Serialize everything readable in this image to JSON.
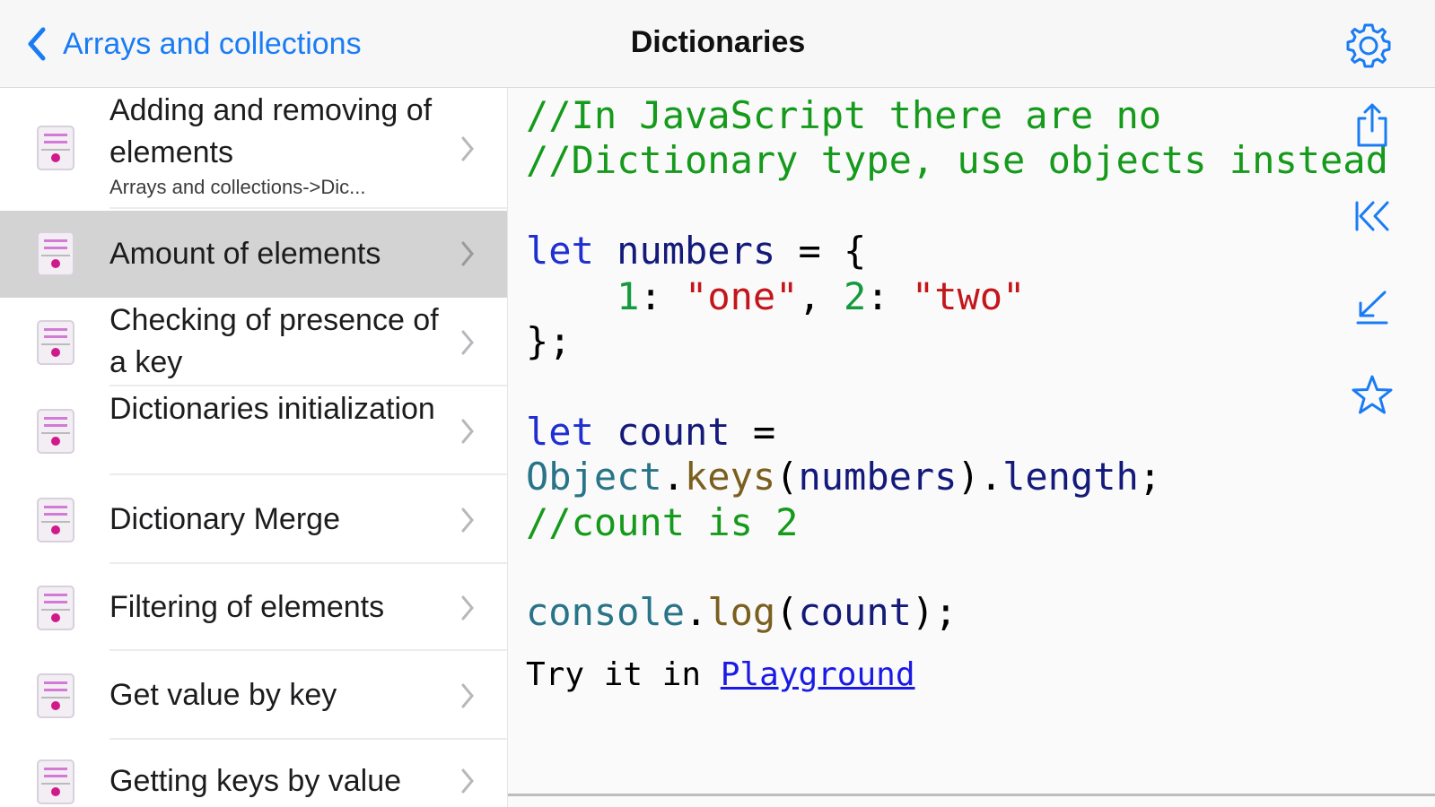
{
  "navbar": {
    "back_label": "Arrays and collections",
    "title": "Dictionaries",
    "settings_icon": "gear-icon",
    "accent": "#1a7cf5"
  },
  "sidebar": {
    "items": [
      {
        "title": "Adding and removing of elements",
        "subtitle": "Arrays and collections->Dic...",
        "selected": false
      },
      {
        "title": "Amount of elements",
        "subtitle": "",
        "selected": true
      },
      {
        "title": "Checking of presence of a key",
        "subtitle": "",
        "selected": false
      },
      {
        "title": "Dictionaries initialization",
        "subtitle": "",
        "selected": false
      },
      {
        "title": "Dictionary Merge",
        "subtitle": "",
        "selected": false
      },
      {
        "title": "Filtering of elements",
        "subtitle": "",
        "selected": false
      },
      {
        "title": "Get value by key",
        "subtitle": "",
        "selected": false
      },
      {
        "title": "Getting keys by value",
        "subtitle": "",
        "selected": false
      }
    ]
  },
  "code": {
    "line1": "//In JavaScript there are no",
    "line2": "//Dictionary type, use objects instead",
    "kw_let": "let",
    "numbers": "numbers",
    "assign_open": " = {",
    "indent": "    ",
    "num1": "1",
    "colon": ": ",
    "str_one": "\"one\"",
    "comma": ", ",
    "num2": "2",
    "str_two": "\"two\"",
    "close": "};",
    "count": "count",
    "assign": " =",
    "object": "Object",
    "dot": ".",
    "keys": "keys",
    "paren_open": "(",
    "paren_close": ")",
    "length": "length",
    "semi": ";",
    "comment_count": "//count is 2",
    "console": "console",
    "log": "log",
    "space": " "
  },
  "try_it": {
    "prefix": "Try it in ",
    "link": "Playground"
  },
  "side_actions": [
    "share-icon",
    "first-item-icon",
    "last-item-icon",
    "favorite-star-icon"
  ]
}
